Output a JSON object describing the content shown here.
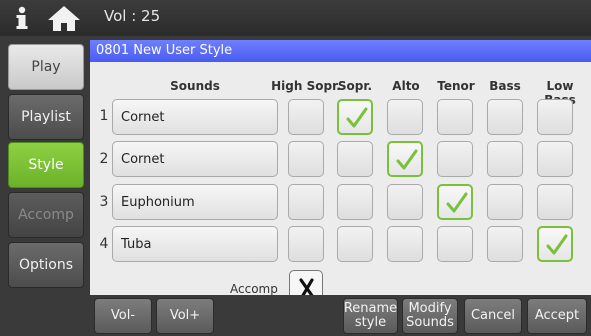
{
  "top_bar": {
    "volume_text": "Vol : 25"
  },
  "nav": [
    {
      "label": "Play"
    },
    {
      "label": "Playlist"
    },
    {
      "label": "Style"
    },
    {
      "label": "Accomp"
    },
    {
      "label": "Options"
    }
  ],
  "style_title": "0801 New User Style",
  "headers": {
    "sounds": "Sounds",
    "voices": [
      "High Sopr.",
      "Sopr.",
      "Alto",
      "Tenor",
      "Bass",
      "Low Bass"
    ]
  },
  "rows": [
    {
      "num": "1",
      "sound": "Cornet",
      "checked_voice": "Sopr."
    },
    {
      "num": "2",
      "sound": "Cornet",
      "checked_voice": "Alto"
    },
    {
      "num": "3",
      "sound": "Euphonium",
      "checked_voice": "Tenor"
    },
    {
      "num": "4",
      "sound": "Tuba",
      "checked_voice": "Low Bass"
    }
  ],
  "accomp": {
    "label": "Accomp",
    "state": "off"
  },
  "buttons": {
    "vol_minus": "Vol-",
    "vol_plus": "Vol+",
    "rename_line1": "Rename",
    "rename_line2": "style",
    "modify_line1": "Modify",
    "modify_line2": "Sounds",
    "cancel": "Cancel",
    "accept": "Accept"
  },
  "colors": {
    "accent_green": "#79c13b",
    "title_blue": "#5566f5"
  }
}
